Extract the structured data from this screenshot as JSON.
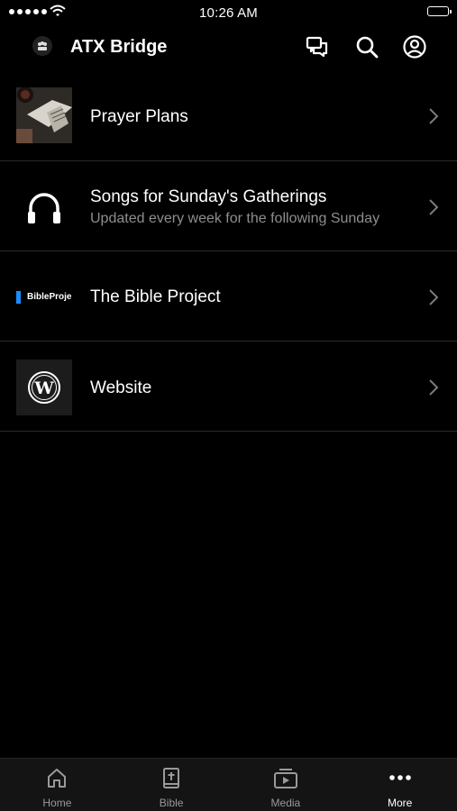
{
  "status_bar": {
    "time": "10:26 AM"
  },
  "header": {
    "title": "ATX Bridge"
  },
  "list": {
    "items": [
      {
        "title": "Prayer Plans",
        "subtitle": "",
        "icon": "photo-thumbnail"
      },
      {
        "title": "Songs for Sunday's Gatherings",
        "subtitle": "Updated every week for the following Sunday",
        "icon": "headphones-icon"
      },
      {
        "title": "The Bible Project",
        "subtitle": "",
        "icon": "bibleproject-logo",
        "logo_text": "BibleProje"
      },
      {
        "title": "Website",
        "subtitle": "",
        "icon": "wordpress-icon"
      }
    ]
  },
  "tabbar": {
    "tabs": [
      {
        "label": "Home",
        "icon": "home-icon"
      },
      {
        "label": "Bible",
        "icon": "bible-icon"
      },
      {
        "label": "Media",
        "icon": "media-icon"
      },
      {
        "label": "More",
        "icon": "more-icon",
        "active": true
      }
    ]
  },
  "colors": {
    "background": "#000000",
    "tabbar_bg": "#141414",
    "subtitle": "#8e8e8e",
    "accent_logo": "#1a8cff"
  }
}
